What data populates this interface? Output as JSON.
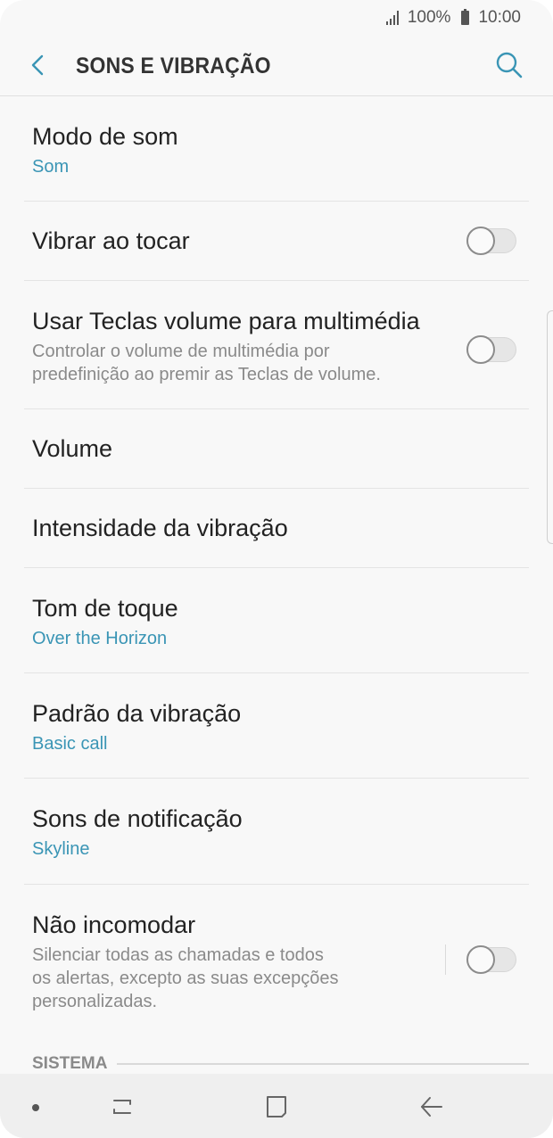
{
  "status_bar": {
    "battery": "100%",
    "time": "10:00"
  },
  "app_bar": {
    "title": "SONS E VIBRAÇÃO"
  },
  "settings": {
    "sound_mode": {
      "title": "Modo de som",
      "value": "Som"
    },
    "vibrate_on_touch": {
      "title": "Vibrar ao tocar",
      "enabled": false
    },
    "volume_keys": {
      "title": "Usar Teclas volume para multimédia",
      "description_line1": "Controlar o volume de multimédia por",
      "description_line2": "predefinição ao premir as Teclas de volume.",
      "enabled": false
    },
    "volume": {
      "title": "Volume"
    },
    "vibration_intensity": {
      "title": "Intensidade da vibração"
    },
    "ringtone": {
      "title": "Tom de toque",
      "value": "Over the Horizon"
    },
    "vibration_pattern": {
      "title": "Padrão da vibração",
      "value": "Basic call"
    },
    "notification_sounds": {
      "title": "Sons de notificação",
      "value": "Skyline"
    },
    "do_not_disturb": {
      "title": "Não incomodar",
      "description_line1": "Silenciar todas as chamadas e todos",
      "description_line2": "os alertas, excepto as suas excepções",
      "description_line3": "personalizadas.",
      "enabled": false
    }
  },
  "section_header": {
    "label": "SISTEMA"
  },
  "icons": {
    "back": "back-arrow-icon",
    "search": "search-icon",
    "recents": "recent-apps-icon",
    "home": "home-icon",
    "nav_back": "nav-back-icon"
  },
  "colors": {
    "accent": "#3a95b5",
    "background": "#f8f8f8"
  }
}
